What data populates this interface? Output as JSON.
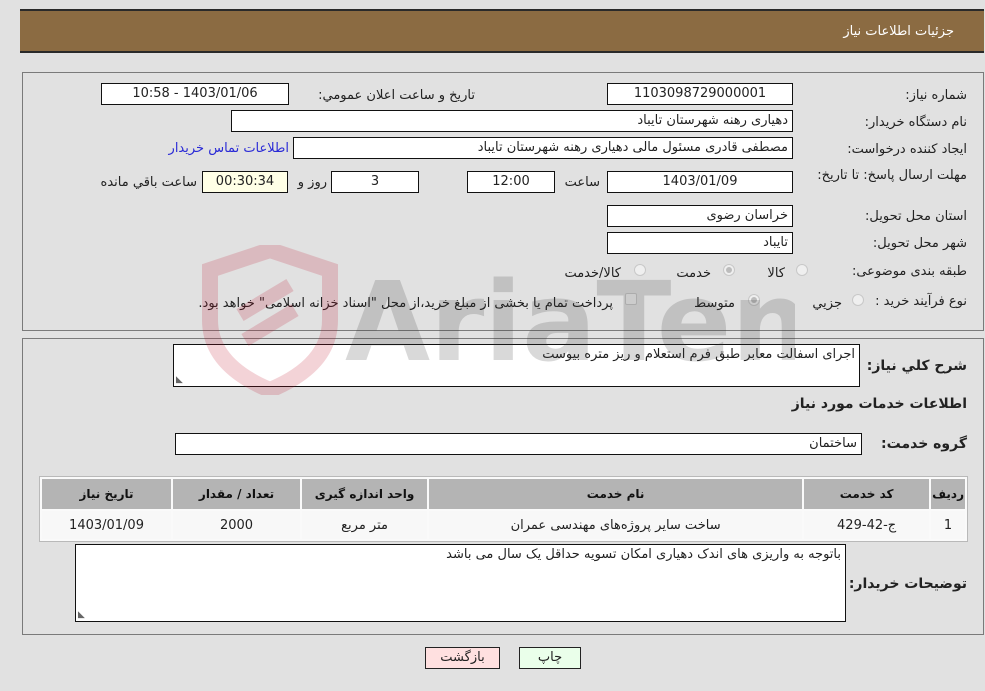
{
  "header": {
    "title": "جزئیات اطلاعات نیاز"
  },
  "form": {
    "need_number": {
      "label": "شماره نیاز:",
      "value": "1103098729000001"
    },
    "announce_datetime": {
      "label": "تاریخ و ساعت اعلان عمومي:",
      "value": "1403/01/06 - 10:58"
    },
    "buyer_org": {
      "label": "نام دستگاه خریدار:",
      "value": "دهیاری رهنه  شهرستان تایباد"
    },
    "requester": {
      "label": "ایجاد کننده درخواست:",
      "value": "مصطفی قادری مسئول مالی دهیاری رهنه  شهرستان تایباد"
    },
    "buyer_contact_link": "اطلاعات تماس خریدار",
    "deadline": {
      "label": "مهلت ارسال پاسخ: تا تاریخ:",
      "date": "1403/01/09",
      "time_label": "ساعت",
      "time": "12:00",
      "days": "3",
      "days_label": "روز و",
      "remaining": "00:30:34",
      "remaining_label": "ساعت باقي مانده"
    },
    "delivery_province": {
      "label": "استان محل تحویل:",
      "value": "خراسان رضوی"
    },
    "delivery_city": {
      "label": "شهر محل تحویل:",
      "value": "تایباد"
    },
    "category": {
      "label": "طبقه بندی موضوعی:",
      "options": [
        "کالا",
        "خدمت",
        "کالا/خدمت"
      ],
      "selected": "خدمت"
    },
    "purchase_type": {
      "label": "نوع فرآیند خرید :",
      "options": [
        "جزيي",
        "متوسط"
      ],
      "selected": "متوسط",
      "treasury_note": "پرداخت تمام یا بخشی از مبلغ خرید،از محل \"اسناد خزانه اسلامی\" خواهد بود.",
      "treasury_checked": false
    }
  },
  "details": {
    "description_label": "شرح کلي نیاز:",
    "description": "اجرای اسفالت معابر طبق فرم استعلام و ریز متره بیوست",
    "services_heading": "اطلاعات خدمات مورد نیاز",
    "service_group_label": "گروه خدمت:",
    "service_group": "ساختمان",
    "table": {
      "headers": [
        "ردیف",
        "کد خدمت",
        "نام خدمت",
        "واحد اندازه گیری",
        "تعداد / مقدار",
        "تاریخ نیاز"
      ],
      "rows": [
        [
          "1",
          "ج-42-429",
          "ساخت سایر پروژه‌های مهندسی عمران",
          "متر مربع",
          "2000",
          "1403/01/09"
        ]
      ]
    },
    "buyer_notes_label": "توضیحات خریدار:",
    "buyer_notes": "باتوجه به واریزی های اندک دهیاری امکان تسویه حداقل یک سال می باشد"
  },
  "buttons": {
    "print": "چاپ",
    "back": "بازگشت"
  },
  "colors": {
    "header_bg": "#8b6b42",
    "print_bg": "#eaffea",
    "back_bg": "#ffe0e0",
    "remaining_bg": "#ffffe6"
  }
}
